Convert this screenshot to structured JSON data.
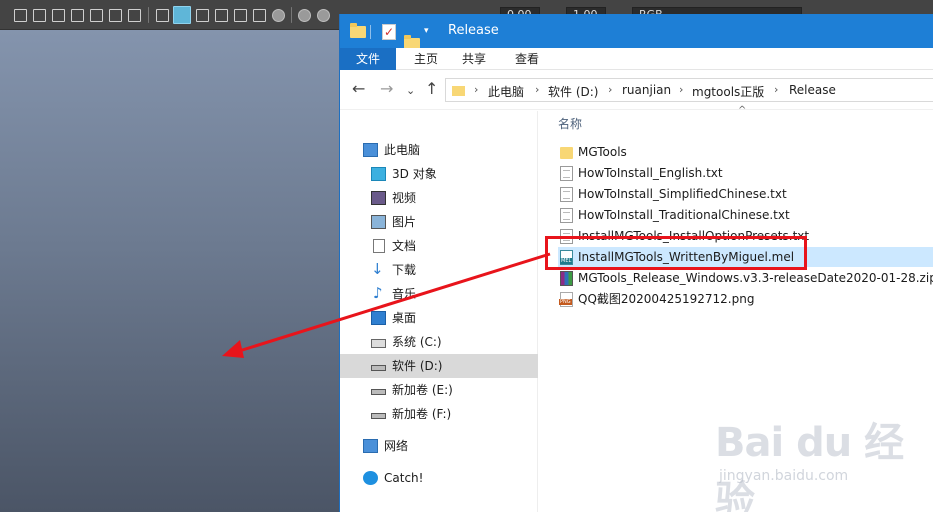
{
  "maya": {
    "toolbar": {
      "field_value_1": "0.00",
      "field_value_2": "1.00",
      "color_space": "RGB"
    }
  },
  "explorer": {
    "title": "Release",
    "qat_dropdown": "▾",
    "ribbon_tabs": [
      "文件",
      "主页",
      "共享",
      "查看"
    ],
    "nav": {
      "back": "←",
      "forward": "→",
      "recent": "⌄",
      "up": "↑"
    },
    "breadcrumb": [
      "此电脑",
      "软件 (D:)",
      "ruanjian",
      "mgtools正版",
      "Release"
    ],
    "breadcrumb_separator": "›",
    "nav_pane": [
      {
        "label": "此电脑",
        "icon": "computer-icon"
      },
      {
        "label": "3D 对象",
        "icon": "3d-objects-icon"
      },
      {
        "label": "视频",
        "icon": "video-icon"
      },
      {
        "label": "图片",
        "icon": "pictures-icon"
      },
      {
        "label": "文档",
        "icon": "documents-icon"
      },
      {
        "label": "下载",
        "icon": "download-icon"
      },
      {
        "label": "音乐",
        "icon": "music-icon"
      },
      {
        "label": "桌面",
        "icon": "desktop-icon"
      },
      {
        "label": "系统 (C:)",
        "icon": "system-drive-icon"
      },
      {
        "label": "软件 (D:)",
        "icon": "drive-icon"
      },
      {
        "label": "新加卷 (E:)",
        "icon": "drive-icon"
      },
      {
        "label": "新加卷 (F:)",
        "icon": "drive-icon"
      },
      {
        "label": "网络",
        "icon": "network-icon"
      },
      {
        "label": "Catch!",
        "icon": "catch-icon"
      }
    ],
    "selected_nav_index": 9,
    "column_header": "名称",
    "files": [
      {
        "name": "MGTools",
        "type": "folder"
      },
      {
        "name": "HowToInstall_English.txt",
        "type": "txt"
      },
      {
        "name": "HowToInstall_SimplifiedChinese.txt",
        "type": "txt"
      },
      {
        "name": "HowToInstall_TraditionalChinese.txt",
        "type": "txt"
      },
      {
        "name": "InstallMGTools_InstallOptionPresets.txt",
        "type": "txt"
      },
      {
        "name": "InstallMGTools_WrittenByMiguel.mel",
        "type": "mel"
      },
      {
        "name": "MGTools_Release_Windows.v3.3-releaseDate2020-01-28.zip",
        "type": "zip"
      },
      {
        "name": "QQ截图20200425192712.png",
        "type": "png"
      }
    ],
    "selected_file_index": 5
  },
  "annotation": {
    "color": "#e8141b"
  },
  "watermark": {
    "brand": "Bai du 经验",
    "url": "jingyan.baidu.com"
  },
  "colors": {
    "title_bar": "#1e7fd6",
    "file_tab": "#1a6fc4",
    "selection": "#cce8ff"
  }
}
